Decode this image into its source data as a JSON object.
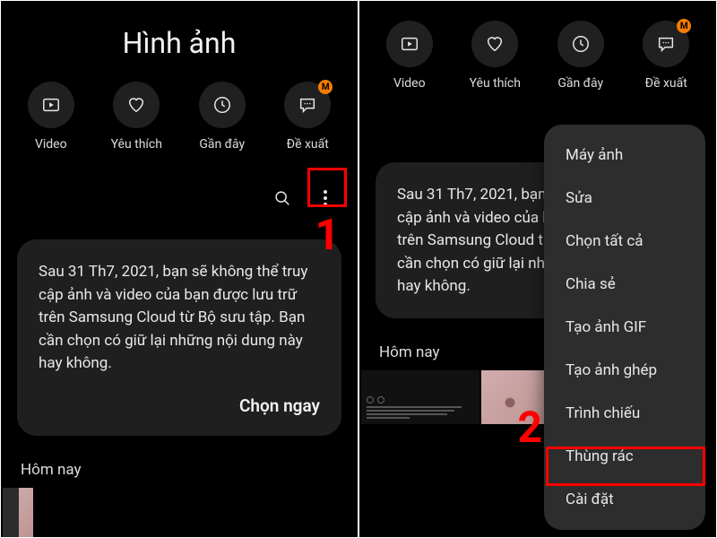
{
  "header": {
    "title": "Hình ảnh"
  },
  "tabs": [
    {
      "label": "Video"
    },
    {
      "label": "Yêu thích"
    },
    {
      "label": "Gần đây"
    },
    {
      "label": "Đề xuất",
      "badge": "M"
    }
  ],
  "notice": {
    "text": "Sau 31 Th7, 2021, bạn sẽ không thể truy cập ảnh và video của bạn được lưu trữ trên Samsung Cloud từ Bộ sưu tập. Bạn cần chọn có giữ lại những nội dung này hay không.",
    "cta": "Chọn ngay"
  },
  "notice2": {
    "text_partial": "Sau 31 Th7, 2021, bạn s\ncập ảnh và video của b\ntrên Samsung Cloud từ\ncần chọn có giữ lại nhữ\nhay không."
  },
  "section": {
    "today": "Hôm nay"
  },
  "steps": {
    "one": "1",
    "two": "2"
  },
  "menu": {
    "items": [
      "Máy ảnh",
      "Sửa",
      "Chọn tất cả",
      "Chia sẻ",
      "Tạo ảnh GIF",
      "Tạo ảnh ghép",
      "Trình chiếu",
      "Thùng rác",
      "Cài đặt"
    ]
  }
}
